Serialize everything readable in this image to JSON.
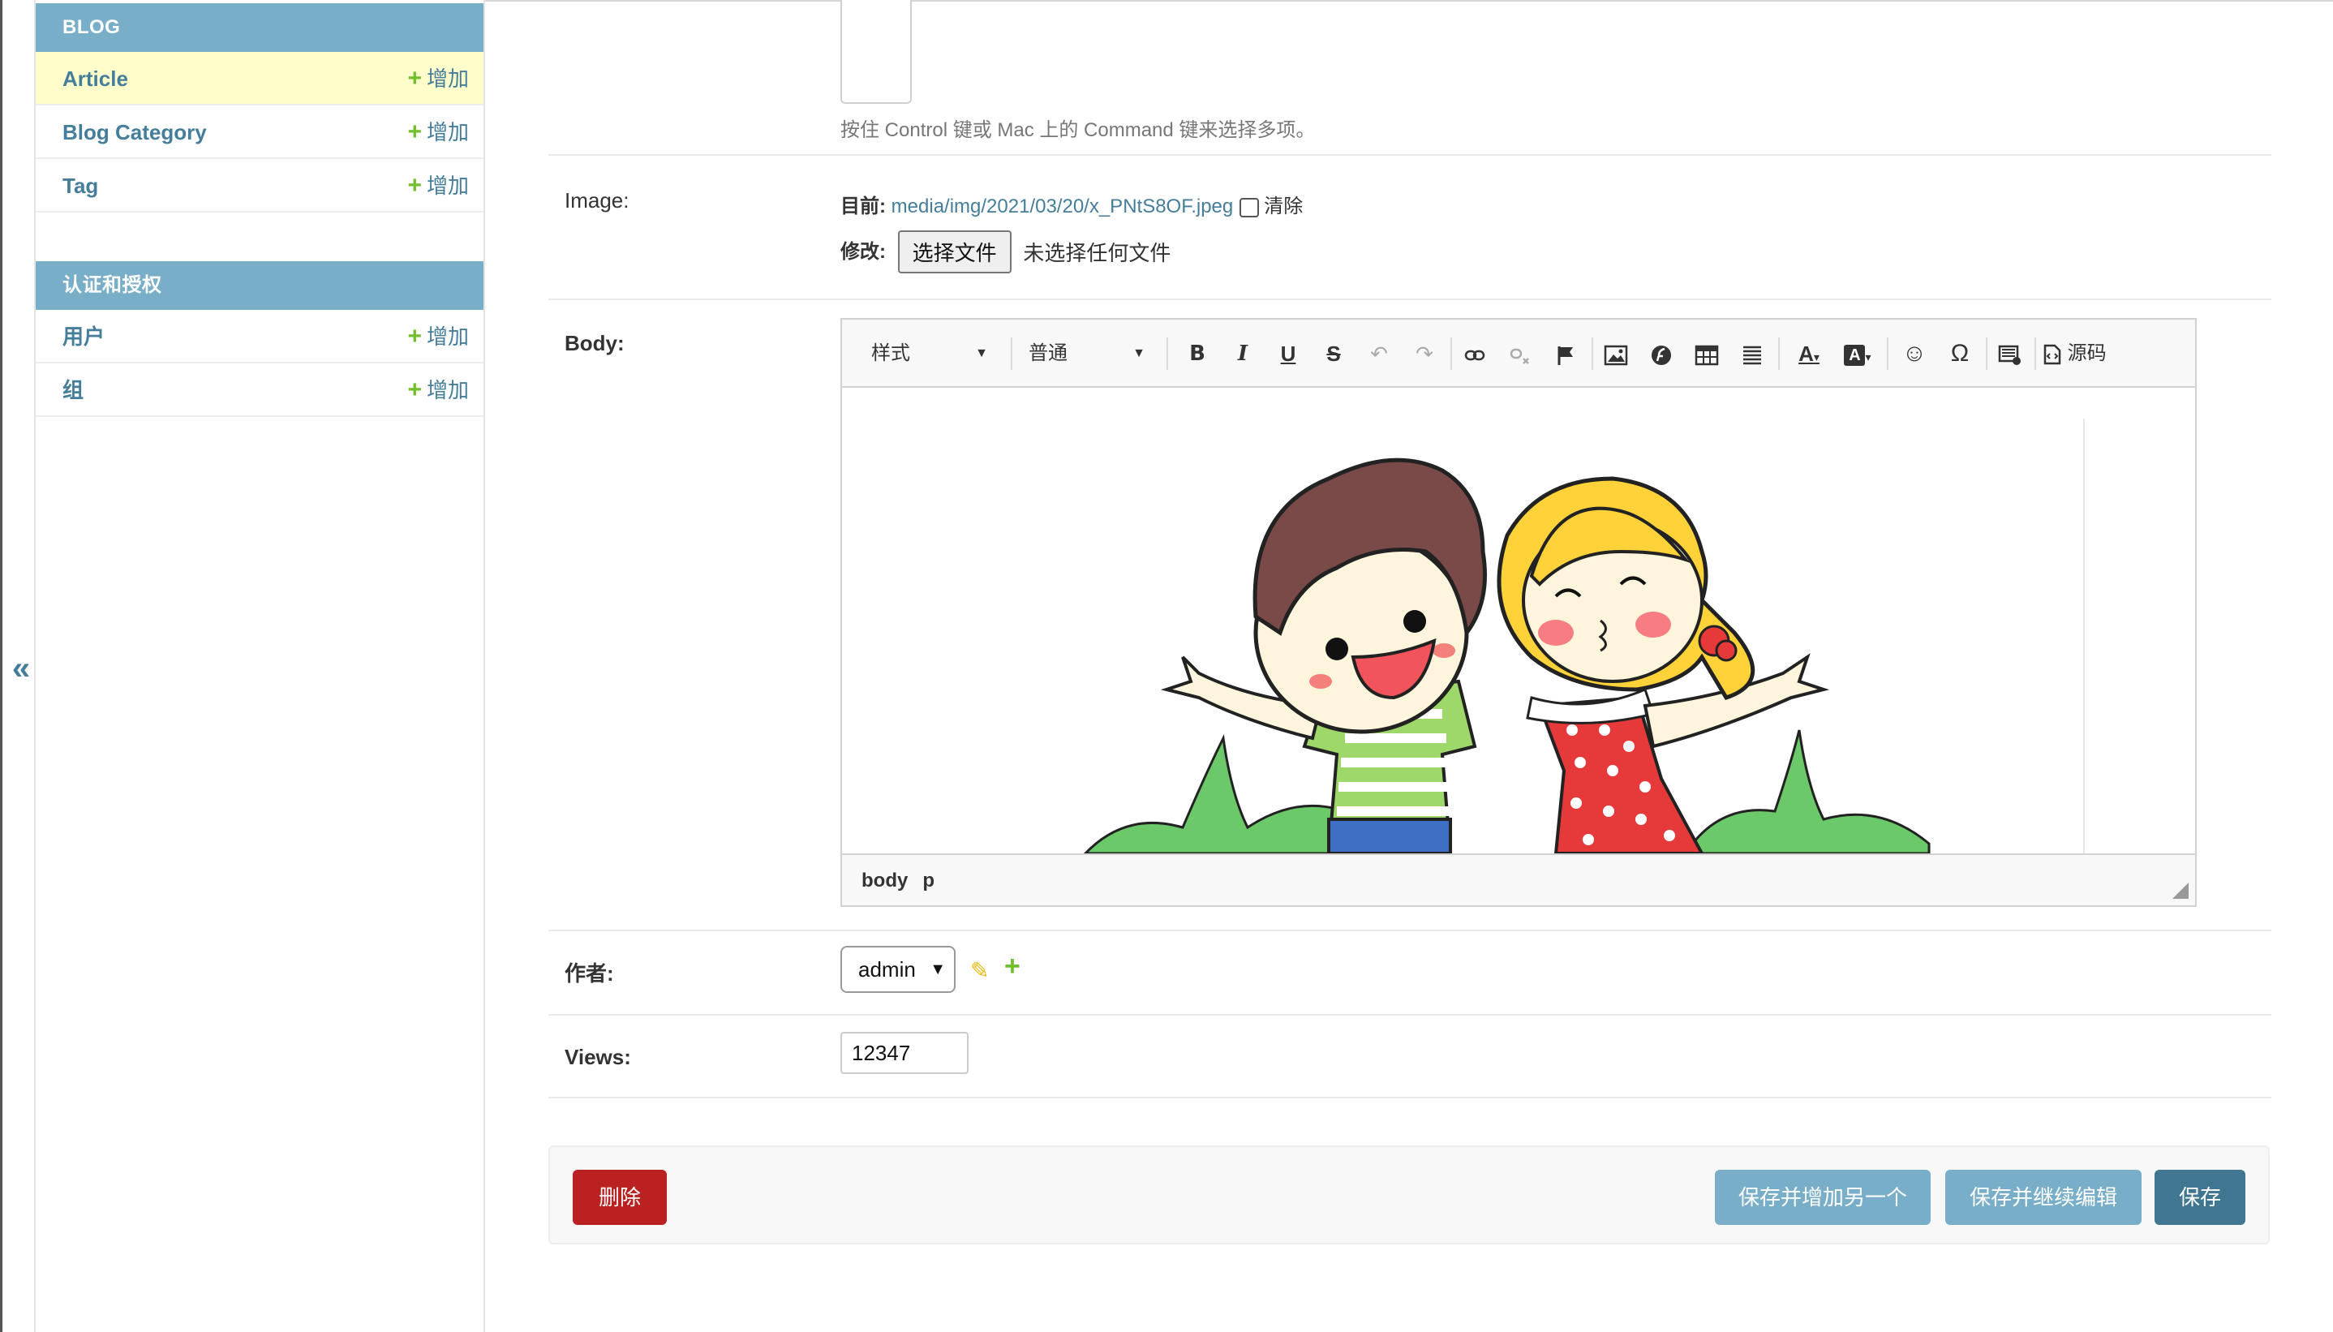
{
  "sidebar": {
    "modules": [
      {
        "caption": "BLOG",
        "items": [
          {
            "name": "Article",
            "add": "增加"
          },
          {
            "name": "Blog Category",
            "add": "增加"
          },
          {
            "name": "Tag",
            "add": "增加"
          }
        ]
      },
      {
        "caption": "认证和授权",
        "items": [
          {
            "name": "用户",
            "add": "增加"
          },
          {
            "name": "组",
            "add": "增加"
          }
        ]
      }
    ]
  },
  "collapse_label": "«",
  "form": {
    "tags_help": "按住 Control 键或 Mac 上的 Command 键来选择多项。",
    "image": {
      "label": "Image:",
      "current_label": "目前:",
      "current_file": "media/img/2021/03/20/x_PNtS8OF.jpeg",
      "clear_label": "清除",
      "change_label": "修改:",
      "choose_button": "选择文件",
      "no_file": "未选择任何文件"
    },
    "body": {
      "label": "Body:",
      "style_combo": "样式",
      "format_combo": "普通",
      "source_label": "源码",
      "path": [
        "body",
        "p"
      ]
    },
    "author": {
      "label": "作者:",
      "selected": "admin"
    },
    "views": {
      "label": "Views:",
      "value": "12347"
    }
  },
  "buttons": {
    "delete": "删除",
    "save_add_another": "保存并增加另一个",
    "save_continue": "保存并继续编辑",
    "save": "保存"
  },
  "colors": {
    "module_header": "#79aec8",
    "link": "#447e9b",
    "add_plus": "#70bf2b",
    "delete": "#ba2121",
    "save": "#417690",
    "active_row": "#ffffcc"
  }
}
